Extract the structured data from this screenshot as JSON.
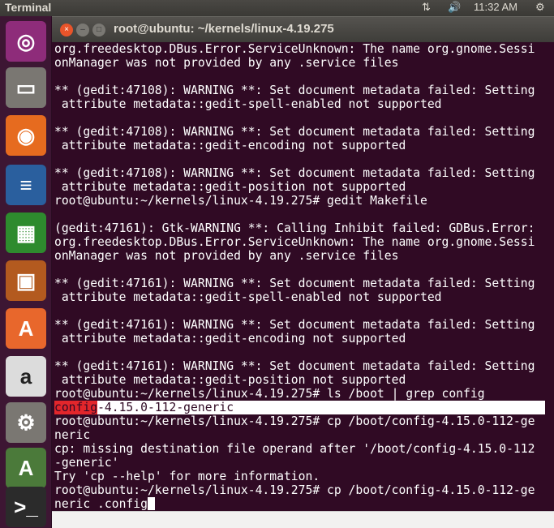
{
  "topbar": {
    "app": "Terminal",
    "time": "11:32 AM",
    "icons": [
      "network-icon",
      "volume-icon",
      "power-gear-icon"
    ]
  },
  "launcher": [
    {
      "name": "ubuntu-dash",
      "glyph": "◎",
      "color": "#8e2c7a"
    },
    {
      "name": "files",
      "glyph": "▭",
      "color": "#7a7772"
    },
    {
      "name": "firefox",
      "glyph": "◉",
      "color": "#e66b1f"
    },
    {
      "name": "libreoffice-writer",
      "glyph": "≡",
      "color": "#2a5f9e"
    },
    {
      "name": "libreoffice-calc",
      "glyph": "▦",
      "color": "#2e8b2e"
    },
    {
      "name": "libreoffice-impress",
      "glyph": "▣",
      "color": "#b35a1f"
    },
    {
      "name": "ubuntu-software",
      "glyph": "A",
      "color": "#e8672c"
    },
    {
      "name": "amazon",
      "glyph": "a",
      "color": "#dcdcdc"
    },
    {
      "name": "system-settings",
      "glyph": "⚙",
      "color": "#7a7772"
    },
    {
      "name": "software-updater",
      "glyph": "A",
      "color": "#4b7a3a"
    },
    {
      "name": "terminal",
      "glyph": ">_",
      "color": "#2b2b2b"
    }
  ],
  "window": {
    "title": "root@ubuntu: ~/kernels/linux-4.19.275"
  },
  "terminal": {
    "lines": [
      "org.freedesktop.DBus.Error.ServiceUnknown: The name org.gnome.Sessi",
      "onManager was not provided by any .service files",
      "",
      "** (gedit:47108): WARNING **: Set document metadata failed: Setting",
      " attribute metadata::gedit-spell-enabled not supported",
      "",
      "** (gedit:47108): WARNING **: Set document metadata failed: Setting",
      " attribute metadata::gedit-encoding not supported",
      "",
      "** (gedit:47108): WARNING **: Set document metadata failed: Setting",
      " attribute metadata::gedit-position not supported",
      "root@ubuntu:~/kernels/linux-4.19.275# gedit Makefile",
      "",
      "(gedit:47161): Gtk-WARNING **: Calling Inhibit failed: GDBus.Error:",
      "org.freedesktop.DBus.Error.ServiceUnknown: The name org.gnome.Sessi",
      "onManager was not provided by any .service files",
      "",
      "** (gedit:47161): WARNING **: Set document metadata failed: Setting",
      " attribute metadata::gedit-spell-enabled not supported",
      "",
      "** (gedit:47161): WARNING **: Set document metadata failed: Setting",
      " attribute metadata::gedit-encoding not supported",
      "",
      "** (gedit:47161): WARNING **: Set document metadata failed: Setting",
      " attribute metadata::gedit-position not supported",
      "root@ubuntu:~/kernels/linux-4.19.275# ls /boot | grep config"
    ],
    "match_prefix": "config",
    "match_rest": "-4.15.0-112-generic",
    "lines_after": [
      "root@ubuntu:~/kernels/linux-4.19.275# cp /boot/config-4.15.0-112-ge",
      "neric",
      "cp: missing destination file operand after '/boot/config-4.15.0-112",
      "-generic'",
      "Try 'cp --help' for more information.",
      "root@ubuntu:~/kernels/linux-4.19.275# cp /boot/config-4.15.0-112-ge"
    ],
    "current_input": "neric .config"
  }
}
